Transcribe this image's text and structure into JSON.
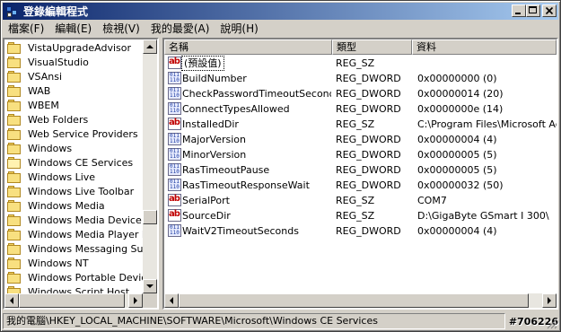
{
  "window": {
    "title": "登錄編輯程式"
  },
  "menu": [
    "檔案(F)",
    "編輯(E)",
    "檢視(V)",
    "我的最愛(A)",
    "說明(H)"
  ],
  "tree": [
    {
      "label": "VistaUpgradeAdvisor",
      "selected": false,
      "open": false
    },
    {
      "label": "VisualStudio",
      "selected": false,
      "open": false
    },
    {
      "label": "VSAnsi",
      "selected": false,
      "open": false
    },
    {
      "label": "WAB",
      "selected": false,
      "open": false
    },
    {
      "label": "WBEM",
      "selected": false,
      "open": false
    },
    {
      "label": "Web Folders",
      "selected": false,
      "open": false
    },
    {
      "label": "Web Service Providers",
      "selected": false,
      "open": false
    },
    {
      "label": "Windows",
      "selected": false,
      "open": false
    },
    {
      "label": "Windows CE Services",
      "selected": true,
      "open": true
    },
    {
      "label": "Windows Live",
      "selected": false,
      "open": false
    },
    {
      "label": "Windows Live Toolbar",
      "selected": false,
      "open": false
    },
    {
      "label": "Windows Media",
      "selected": false,
      "open": false
    },
    {
      "label": "Windows Media Device Man",
      "selected": false,
      "open": false
    },
    {
      "label": "Windows Media Player NSS",
      "selected": false,
      "open": false
    },
    {
      "label": "Windows Messaging Subsys",
      "selected": false,
      "open": false
    },
    {
      "label": "Windows NT",
      "selected": false,
      "open": false
    },
    {
      "label": "Windows Portable Devices",
      "selected": false,
      "open": false
    },
    {
      "label": "Windows Script Host",
      "selected": false,
      "open": false
    }
  ],
  "columns": [
    "名稱",
    "類型",
    "資料"
  ],
  "values": [
    {
      "name": "(預設值)",
      "type": "REG_SZ",
      "data": "",
      "icon": "string-value-icon"
    },
    {
      "name": "BuildNumber",
      "type": "REG_DWORD",
      "data": "0x00000000 (0)",
      "icon": "dword-value-icon"
    },
    {
      "name": "CheckPasswordTimeoutSeconds",
      "type": "REG_DWORD",
      "data": "0x00000014 (20)",
      "icon": "dword-value-icon"
    },
    {
      "name": "ConnectTypesAllowed",
      "type": "REG_DWORD",
      "data": "0x0000000e (14)",
      "icon": "dword-value-icon"
    },
    {
      "name": "InstalledDir",
      "type": "REG_SZ",
      "data": "C:\\Program Files\\Microsoft Active",
      "icon": "string-value-icon"
    },
    {
      "name": "MajorVersion",
      "type": "REG_DWORD",
      "data": "0x00000004 (4)",
      "icon": "dword-value-icon"
    },
    {
      "name": "MinorVersion",
      "type": "REG_DWORD",
      "data": "0x00000005 (5)",
      "icon": "dword-value-icon"
    },
    {
      "name": "RasTimeoutPause",
      "type": "REG_DWORD",
      "data": "0x00000005 (5)",
      "icon": "dword-value-icon"
    },
    {
      "name": "RasTimeoutResponseWait",
      "type": "REG_DWORD",
      "data": "0x00000032 (50)",
      "icon": "dword-value-icon"
    },
    {
      "name": "SerialPort",
      "type": "REG_SZ",
      "data": "COM7",
      "icon": "string-value-icon"
    },
    {
      "name": "SourceDir",
      "type": "REG_SZ",
      "data": "D:\\GigaByte GSmart I 300\\",
      "icon": "string-value-icon"
    },
    {
      "name": "WaitV2TimeoutSeconds",
      "type": "REG_DWORD",
      "data": "0x00000004 (4)",
      "icon": "dword-value-icon"
    }
  ],
  "status": {
    "path": "我的電腦\\HKEY_LOCAL_MACHINE\\SOFTWARE\\Microsoft\\Windows CE Services",
    "badge": "#706226"
  },
  "colors": {
    "titlebar_start": "#0a246a",
    "titlebar_end": "#a6caf0",
    "selection": "#0a246a",
    "face": "#d4d0c8"
  }
}
